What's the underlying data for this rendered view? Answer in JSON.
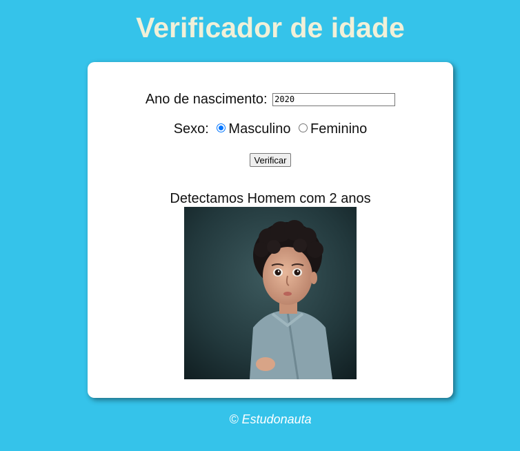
{
  "page": {
    "title": "Verificador de idade",
    "footer": "© Estudonauta"
  },
  "form": {
    "year_label": "Ano de nascimento:",
    "year_value": "2020",
    "sex_label": "Sexo:",
    "options": [
      {
        "label": "Masculino",
        "checked": true
      },
      {
        "label": "Feminino",
        "checked": false
      }
    ],
    "button_label": "Verificar"
  },
  "result": {
    "text": "Detectamos Homem com 2 anos",
    "image": "child-photo"
  },
  "colors": {
    "background": "#35c3ea",
    "title": "#f1f0d8",
    "radio_accent": "#0075ff"
  }
}
